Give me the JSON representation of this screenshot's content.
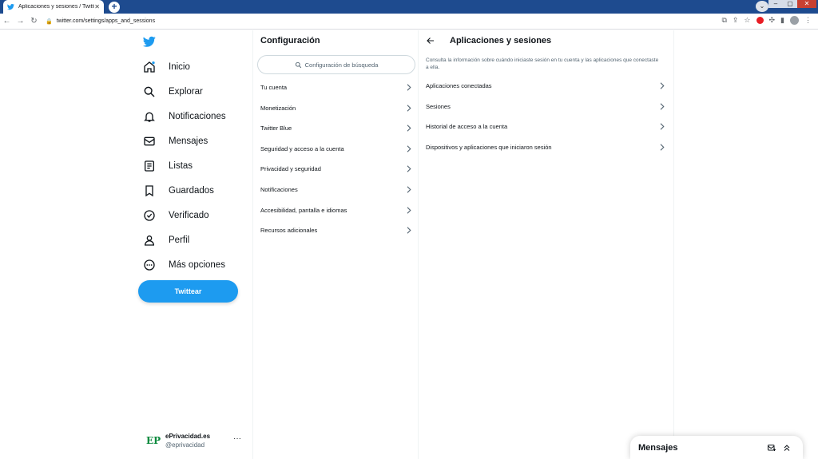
{
  "browser": {
    "tab_title": "Aplicaciones y sesiones / Twitter",
    "tab_close": "✕",
    "new_tab": "+",
    "url": "twitter.com/settings/apps_and_sessions"
  },
  "nav": {
    "items": [
      {
        "label": "Inicio",
        "icon": "home-icon"
      },
      {
        "label": "Explorar",
        "icon": "search-icon"
      },
      {
        "label": "Notificaciones",
        "icon": "bell-icon"
      },
      {
        "label": "Mensajes",
        "icon": "mail-icon"
      },
      {
        "label": "Listas",
        "icon": "list-icon"
      },
      {
        "label": "Guardados",
        "icon": "bookmark-icon"
      },
      {
        "label": "Verificado",
        "icon": "verified-icon"
      },
      {
        "label": "Perfil",
        "icon": "person-icon"
      },
      {
        "label": "Más opciones",
        "icon": "more-icon"
      }
    ],
    "tweet_button": "Twittear",
    "account": {
      "logo": "EP",
      "name": "ePrivacidad.es",
      "handle": "@eprivacidad",
      "more": "···"
    }
  },
  "settings": {
    "title": "Configuración",
    "search_placeholder": "Configuración de búsqueda",
    "items": [
      "Tu cuenta",
      "Monetización",
      "Twitter Blue",
      "Seguridad y acceso a la cuenta",
      "Privacidad y seguridad",
      "Notificaciones",
      "Accesibilidad, pantalla e idiomas",
      "Recursos adicionales"
    ]
  },
  "detail": {
    "title": "Aplicaciones y sesiones",
    "description": "Consulta la información sobre cuándo iniciaste sesión en tu cuenta y las aplicaciones que conectaste a ella.",
    "items": [
      "Aplicaciones conectadas",
      "Sesiones",
      "Historial de acceso a la cuenta",
      "Dispositivos y aplicaciones que iniciaron sesión"
    ]
  },
  "messages_drawer": {
    "title": "Mensajes"
  },
  "colors": {
    "accent": "#1d9bf0",
    "titlebar": "#1e4b8f",
    "text": "#0f1419",
    "muted": "#536471"
  }
}
